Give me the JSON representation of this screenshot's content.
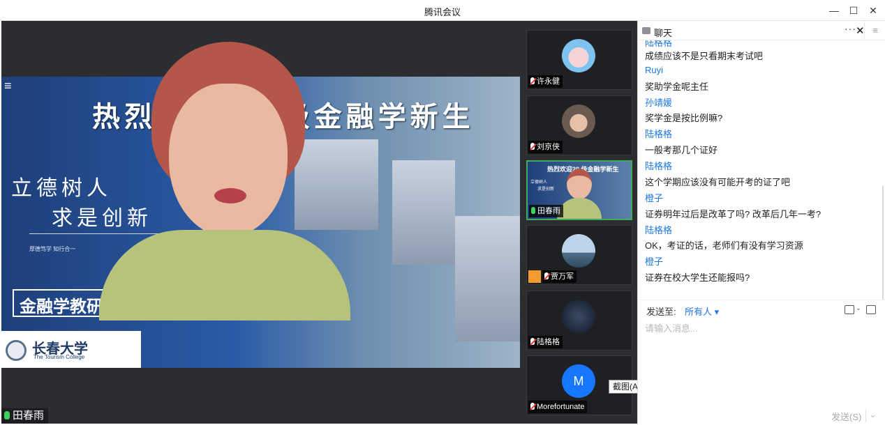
{
  "window": {
    "title": "腾讯会议",
    "minimize": "—",
    "maximize": "☐",
    "close": "✕"
  },
  "main_video": {
    "speaker_name": "田春雨",
    "slide": {
      "headline": "热烈欢迎20  级金融学新生",
      "motto_line1": "立德树人",
      "motto_line2": "求是创新",
      "small_text": "厚德笃学  知行合一",
      "department": "金融学教研室",
      "school_name": "长春大学",
      "school_sub": "The Tourism College"
    }
  },
  "participants": [
    {
      "name": "许永健",
      "mic": "muted"
    },
    {
      "name": "刘京侠",
      "mic": "muted"
    },
    {
      "name": "田春雨",
      "mic": "active",
      "thumb_headline": "热烈欢迎20  级金融学新生",
      "thumb_motto1": "立德树人",
      "thumb_motto2": "求是创新"
    },
    {
      "name": "贾万军",
      "mic": "muted"
    },
    {
      "name": "陆格格",
      "mic": "muted"
    },
    {
      "name": "Morefortunate",
      "mic": "muted",
      "initial": "M"
    }
  ],
  "tooltip": "截图(Alt + A)",
  "chat": {
    "header_title": "聊天",
    "more": "···",
    "close": "✕",
    "side_menu": "≡",
    "messages": [
      {
        "sender": "陆格格",
        "text": "成绩应该不是只看期末考试吧"
      },
      {
        "sender": "Ruyi",
        "text": "奖助学金呢主任"
      },
      {
        "sender": "孙靖媛",
        "text": "奖学金是按比例嘛?"
      },
      {
        "sender": "陆格格",
        "text": "一般考那几个证好"
      },
      {
        "sender": "陆格格",
        "text": "这个学期应该没有可能开考的证了吧"
      },
      {
        "sender": "橙子",
        "text": "证券明年过后是改革了吗? 改革后几年一考?"
      },
      {
        "sender": "陆格格",
        "text": "OK，考证的话，老师们有没有学习资源"
      },
      {
        "sender": "橙子",
        "text": "证券在校大学生还能报吗?"
      }
    ],
    "send_to_label": "发送至:",
    "recipient": "所有人 ▾",
    "input_placeholder": "请输入消息...",
    "send_button": "发送(S)",
    "send_dropdown": "⌄"
  },
  "colors": {
    "accent": "#1e78e0",
    "dark_bg": "#2b2d30",
    "mic_active": "#3fd15a",
    "mic_muted_slash": "#e23b3b",
    "active_tile_border": "#3fae5c"
  }
}
